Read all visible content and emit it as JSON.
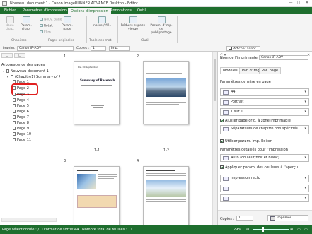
{
  "window": {
    "title": "Nouveau document 1 - Canon imageRUNNER ADVANCE Desktop - Editor"
  },
  "tabs": [
    "Fichier",
    "Paramètres d'impression",
    "Options d'impression",
    "Annotations",
    "Outil"
  ],
  "ribbon": {
    "new_chapter": "Nouv. chap.",
    "chapter_params": "Param. chap.",
    "new_page": "Nouv. page",
    "rotate": "Rotat.",
    "delete": "Élim.",
    "page_params": "Param. page",
    "insert_tab": "Insérer/Mél.",
    "reduce_blank": "Réduire espace vierge",
    "print_params": "Param. d'imp. de publipostage",
    "groups": [
      "Chapitres",
      "Pages originales",
      "Table des mat.",
      "Outil"
    ]
  },
  "toolbar": {
    "print_label": "Imprim.:",
    "printer": "Canon iR-ADV",
    "copies_label": "Copies :",
    "copies": "1",
    "print_button": "Imp.",
    "show_annot": "Afficher annot."
  },
  "tree": {
    "header": "Arborescence des pages",
    "items": [
      {
        "label": "Nouveau document 1",
        "level": 0
      },
      {
        "label": "(Chapitre1) Summary of P",
        "level": 1
      },
      {
        "label": "Page 1",
        "level": 2
      },
      {
        "label": "Page 2",
        "level": 2,
        "highlighted": true
      },
      {
        "label": "Page 3",
        "level": 2
      },
      {
        "label": "Page 4",
        "level": 2
      },
      {
        "label": "Page 5",
        "level": 2
      },
      {
        "label": "Page 6",
        "level": 2
      },
      {
        "label": "Page 7",
        "level": 2
      },
      {
        "label": "Page 8",
        "level": 2
      },
      {
        "label": "Page 9",
        "level": 2
      },
      {
        "label": "Page 10",
        "level": 2
      },
      {
        "label": "Page 11",
        "level": 2
      }
    ]
  },
  "center": {
    "chapter_nums": [
      "1",
      "2",
      "3",
      "4"
    ],
    "page_labels": [
      "1-1",
      "1-2"
    ],
    "page1_title": "Summary of Research",
    "page1_date": "Pre. 00 September"
  },
  "right": {
    "printer_label": "Nom de l'imprimante :",
    "printer_value": "Canon iR-ADV",
    "tabs": [
      "Modèles",
      "Par. d'img.",
      "Par. page"
    ],
    "section1": "Paramètres de mise en page",
    "size": "A4",
    "orientation": "Portrait",
    "layout": "1 sur 1",
    "adjust_chk": "Ajuster page orig. à zone imprimable",
    "separator": "Séparateurs de chapitre non spécifiés",
    "use_editor": "Utiliser param. imp. Editor",
    "section2": "Paramètres détaillés pour l'impression",
    "color": "Auto (couleur/noir et blanc)",
    "apply_color": "Appliquer param. des couleurs à l'aperçu",
    "duplex": "Impression recto",
    "copies_label": "Copies :",
    "copies": "1",
    "print_button": "Imprimer"
  },
  "status": {
    "selected": "Page sélectionnée : /11",
    "format": "Format de sortie:A4",
    "total": "Nombre total de feuilles : 11",
    "zoom": "29%"
  },
  "colors": {
    "accent": "#1e6e2e",
    "highlight": "#e02020"
  }
}
